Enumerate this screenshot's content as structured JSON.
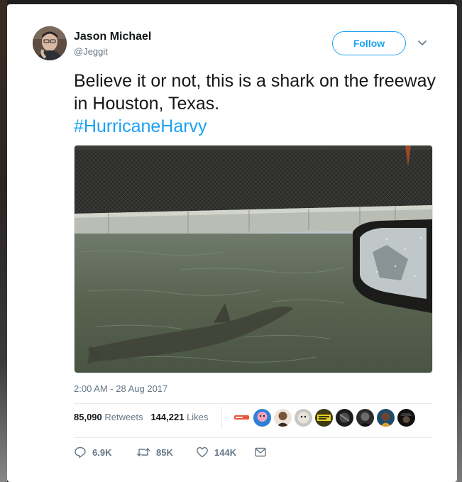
{
  "author": {
    "name": "Jason Michael",
    "handle": "@Jeggit",
    "avatar_icon": "profile-photo"
  },
  "follow_label": "Follow",
  "tweet": {
    "text": "Believe it or not, this is a shark on the freeway in Houston, Texas.",
    "hashtag": "#HurricaneHarvy"
  },
  "media": {
    "icon": "flooded-freeway-shark-photo"
  },
  "timestamp": "2:00 AM - 28 Aug 2017",
  "stats": {
    "retweets_count": "85,090",
    "retweets_label": "Retweets",
    "likes_count": "144,221",
    "likes_label": "Likes"
  },
  "likers": {
    "icons": [
      "liker-avatar-1",
      "liker-avatar-2",
      "liker-avatar-3",
      "liker-avatar-4",
      "liker-avatar-5",
      "liker-avatar-6",
      "liker-avatar-7",
      "liker-avatar-8",
      "liker-avatar-9",
      "liker-avatar-10"
    ]
  },
  "actions": {
    "reply_count": "6.9K",
    "retweet_count": "85K",
    "like_count": "144K"
  },
  "colors": {
    "accent": "#1da1f2",
    "text": "#14171a",
    "muted": "#657786"
  }
}
